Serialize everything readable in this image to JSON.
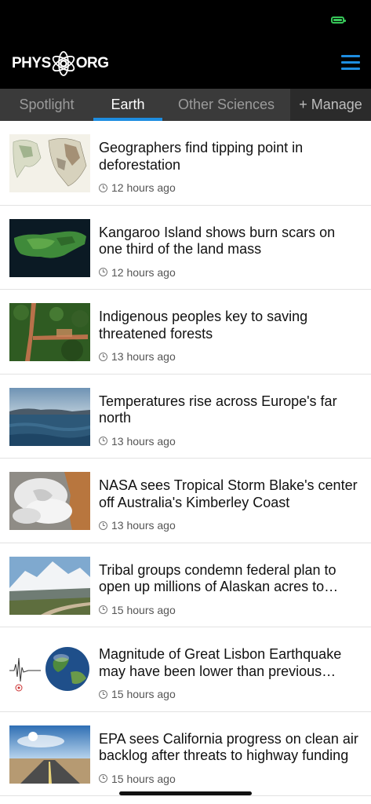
{
  "header": {
    "logo_left": "PHYS",
    "logo_right": "ORG"
  },
  "tabs": [
    {
      "label": "Spotlight",
      "active": false
    },
    {
      "label": "Earth",
      "active": true
    },
    {
      "label": "Other Sciences",
      "active": false
    },
    {
      "label": "+ Manage",
      "active": false
    }
  ],
  "articles": [
    {
      "title": "Geographers find tipping point in deforestation",
      "time": "12 hours ago",
      "thumb": "map-thumbnail"
    },
    {
      "title": "Kangaroo Island shows burn scars on one third of the land mass",
      "time": "12 hours ago",
      "thumb": "satellite-island-thumbnail"
    },
    {
      "title": "Indigenous peoples key to saving threatened forests",
      "time": "13 hours ago",
      "thumb": "forest-aerial-thumbnail"
    },
    {
      "title": "Temperatures rise across Europe's far north",
      "time": "13 hours ago",
      "thumb": "arctic-sea-thumbnail"
    },
    {
      "title": "NASA sees Tropical Storm Blake's center off Australia's Kimberley Coast",
      "time": "13 hours ago",
      "thumb": "storm-satellite-thumbnail"
    },
    {
      "title": "Tribal groups condemn federal plan to open up millions of Alaskan acres to mining",
      "time": "15 hours ago",
      "thumb": "alaska-mountain-thumbnail"
    },
    {
      "title": "Magnitude of Great Lisbon Earthquake may have been lower than previous estimates",
      "time": "15 hours ago",
      "thumb": "globe-seismograph-thumbnail"
    },
    {
      "title": "EPA sees California progress on clean air backlog after threats to highway funding",
      "time": "15 hours ago",
      "thumb": "highway-sky-thumbnail"
    }
  ],
  "colors": {
    "accent": "#1e8de0",
    "header_bg": "#000000",
    "tabs_bg": "#3a3a3a",
    "battery": "#37c759"
  }
}
